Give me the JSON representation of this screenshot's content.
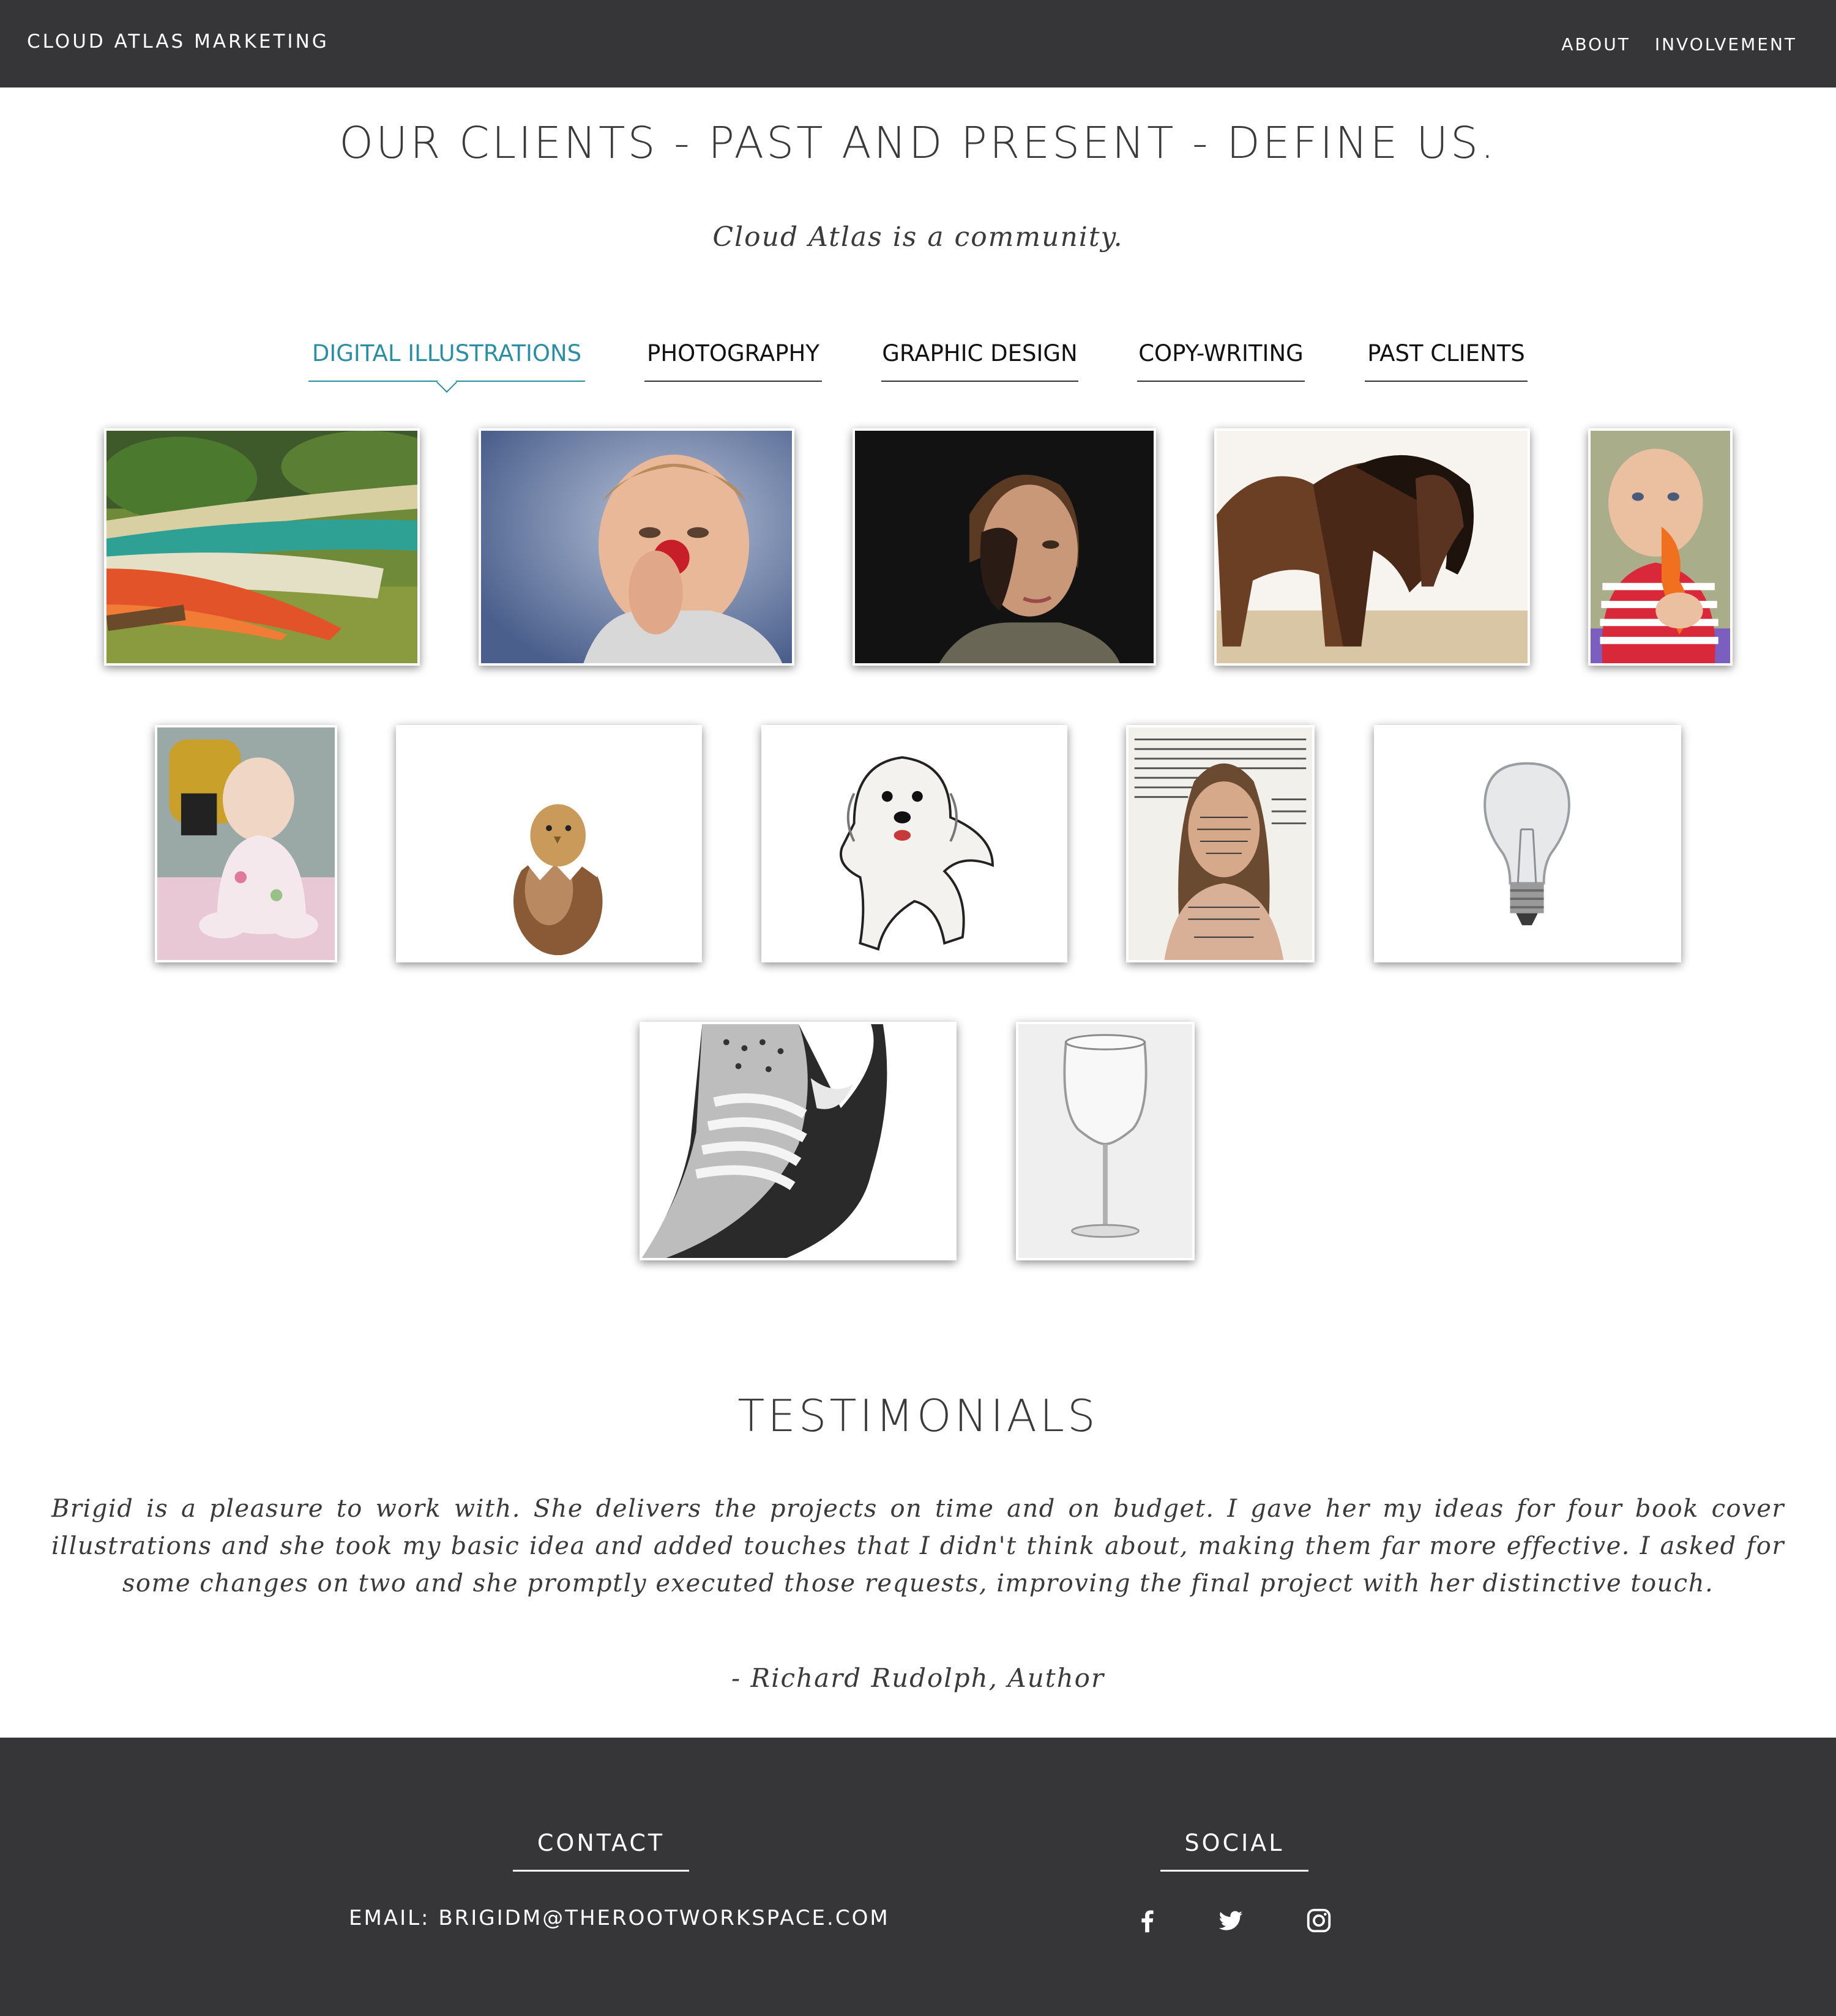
{
  "nav": {
    "brand": "CLOUD ATLAS MARKETING",
    "links": [
      "ABOUT",
      "INVOLVEMENT"
    ]
  },
  "hero": {
    "title": "OUR CLIENTS - PAST AND PRESENT - DEFINE US.",
    "subtitle": "Cloud Atlas is a community."
  },
  "tabs": {
    "items": [
      "DIGITAL ILLUSTRATIONS",
      "PHOTOGRAPHY",
      "GRAPHIC DESIGN",
      "COPY-WRITING",
      "PAST CLIENTS"
    ],
    "active_index": 0
  },
  "gallery": {
    "items": [
      "canoes-illustration",
      "boy-clown-nose-illustration",
      "woman-portrait-illustration",
      "grazing-horses-illustration",
      "baby-teething-illustration",
      "baby-sitting-illustration",
      "hatching-chick-illustration",
      "white-dog-illustration",
      "girl-text-portrait-illustration",
      "light-bulb-illustration",
      "sneaker-illustration",
      "wine-glass-illustration"
    ]
  },
  "testimonials": {
    "title": "TESTIMONIALS",
    "quote": "Brigid is a pleasure to work with. She delivers the projects on time and on budget. I gave her my ideas for four book cover illustrations and she took my basic idea and added touches that I didn't think about, making them far more effective. I asked for some changes on two and she promptly executed those requests, improving the final project with her distinctive touch.",
    "author": "- Richard Rudolph, Author"
  },
  "footer": {
    "contact_heading": "CONTACT",
    "email_label": "EMAIL:",
    "email": "BRIGIDM@THEROOTWORKSPACE.COM",
    "social_heading": "SOCIAL",
    "social_icons": [
      "facebook-icon",
      "twitter-icon",
      "instagram-icon"
    ]
  },
  "colors": {
    "header_bg": "#363638",
    "accent": "#2a8fa5",
    "text": "#3a3a3c"
  }
}
